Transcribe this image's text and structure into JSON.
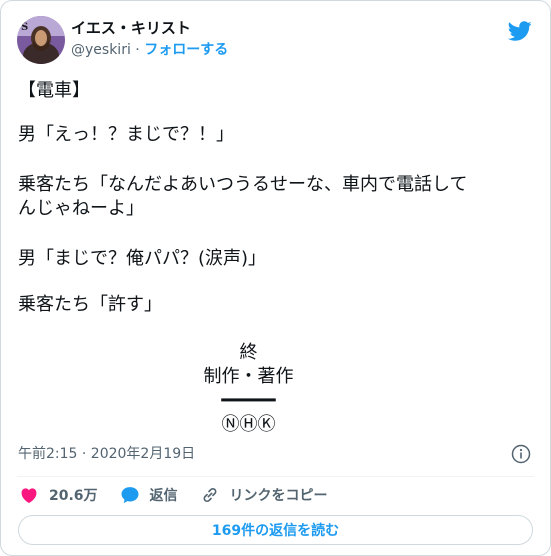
{
  "author": {
    "display_name": "イエス・キリスト",
    "handle": "@yeskiri",
    "separator": " · ",
    "follow_label": "フォローする"
  },
  "tweet": {
    "paragraphs": [
      "【電車】",
      "男「えっ！？まじで？！」",
      "乗客たち「なんだよあいつうるせーな、車内で電話して\nんじゃねーよ」",
      "男「まじで？俺パパ？(涙声)」",
      "乗客たち「許す」"
    ],
    "credits": {
      "end": "終",
      "production": "制作・著作",
      "rule": "━━━━━",
      "broadcaster": "ⓃⒽⓀ"
    },
    "timestamp": "午前2:15 · 2020年2月19日"
  },
  "actions": {
    "like_count": "20.6万",
    "reply_label": "返信",
    "copy_link_label": "リンクをコピー"
  },
  "replies_button": "169件の返信を読む",
  "icons": [
    "avatar",
    "twitter-bird-icon",
    "info-icon",
    "heart-icon",
    "reply-bubble-icon",
    "link-icon"
  ],
  "colors": {
    "accent": "#1d9bf0",
    "like": "#f91880",
    "muted": "#536471"
  }
}
